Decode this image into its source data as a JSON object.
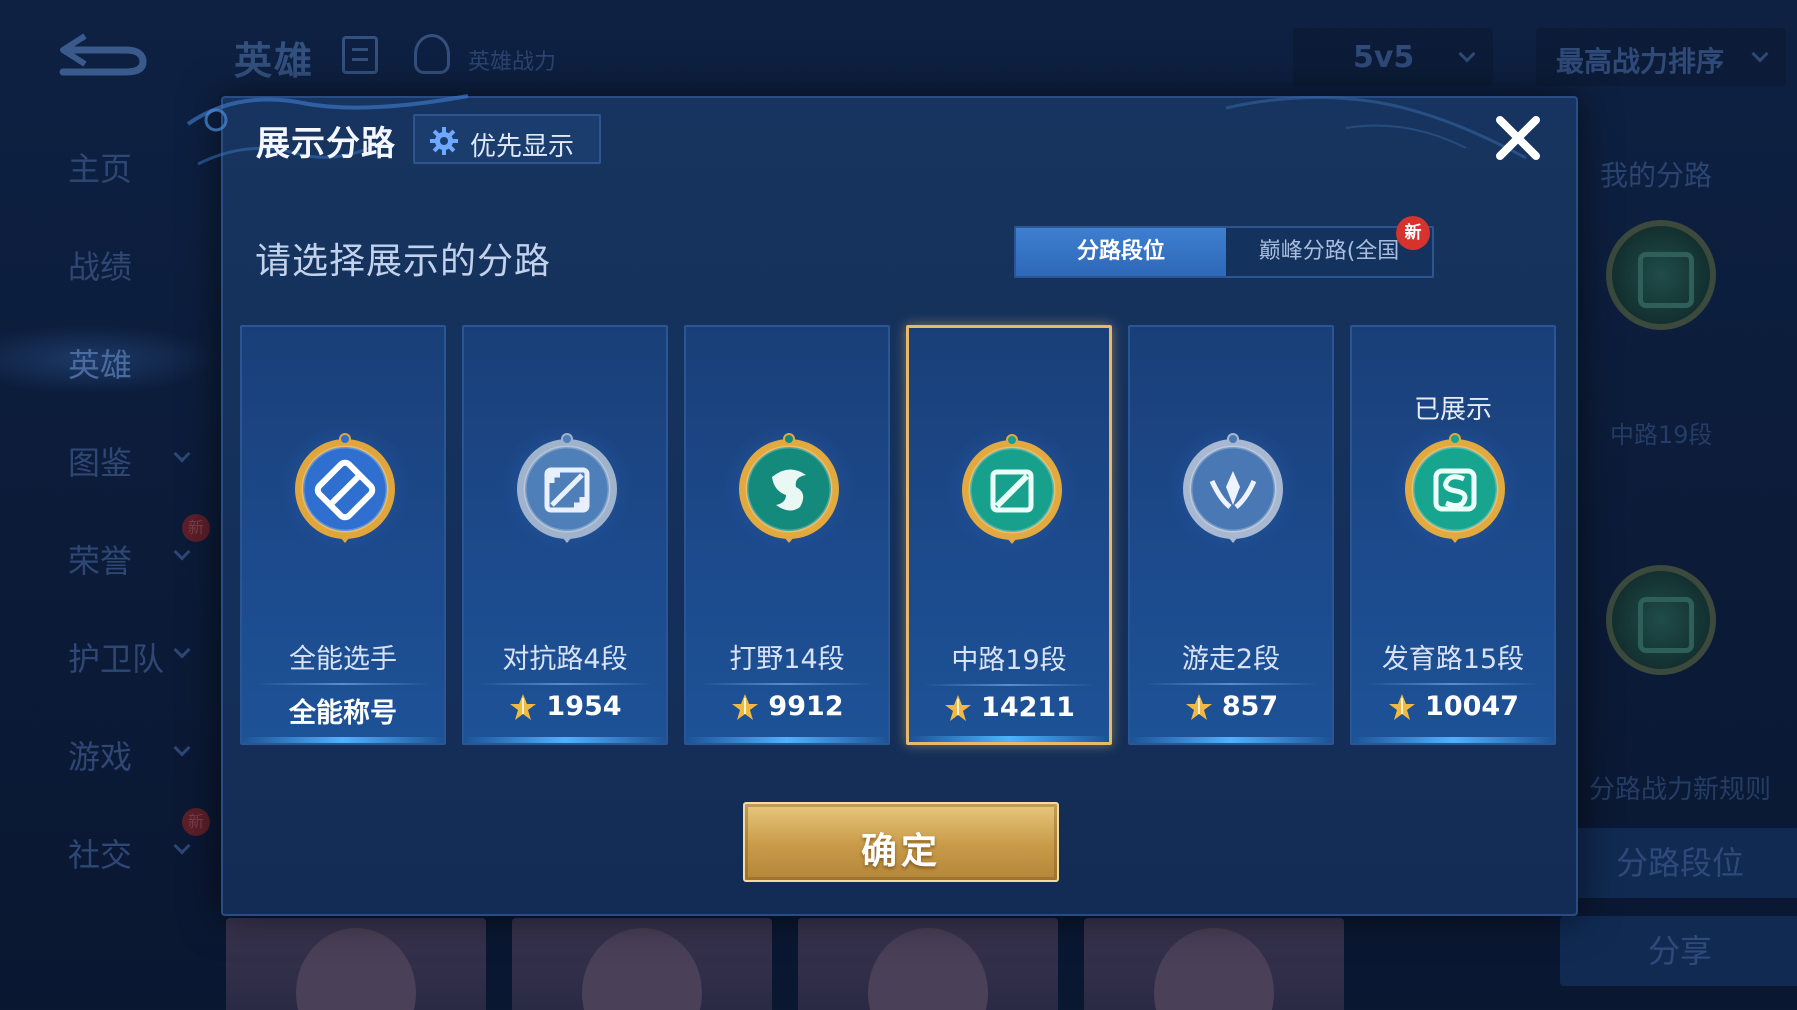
{
  "background": {
    "page_title": "英雄",
    "power_label": "英雄战力",
    "mode_select": "5v5",
    "sort_select": "最高战力排序",
    "sidebar": [
      {
        "label": "主页",
        "chevron": false,
        "new": false
      },
      {
        "label": "战绩",
        "chevron": false,
        "new": false
      },
      {
        "label": "英雄",
        "chevron": false,
        "new": false,
        "active": true
      },
      {
        "label": "图鉴",
        "chevron": true,
        "new": false
      },
      {
        "label": "荣誉",
        "chevron": true,
        "new": true
      },
      {
        "label": "护卫队",
        "chevron": true,
        "new": false
      },
      {
        "label": "游戏",
        "chevron": true,
        "new": false
      },
      {
        "label": "社交",
        "chevron": true,
        "new": true
      }
    ],
    "new_badge": "新",
    "right_panel": {
      "title": "我的分路",
      "lane_rank": "中路19段",
      "rules_link": "分路战力新规则",
      "lane_rank_button": "分路段位",
      "share_button": "分享"
    }
  },
  "dialog": {
    "title": "展示分路",
    "priority_button": "优先显示",
    "subtitle": "请选择展示的分路",
    "tabs": [
      {
        "label": "分路段位",
        "active": true
      },
      {
        "label": "巅峰分路(全国",
        "active": false
      }
    ],
    "new_tag": "新",
    "cards": [
      {
        "name": "全能选手",
        "value": "全能称号",
        "status": "",
        "selected": false,
        "has_score_icon": false,
        "emblem": "all-round",
        "rim": "#e0a63c",
        "core": "#2f6fcf"
      },
      {
        "name": "对抗路4段",
        "value": "1954",
        "status": "",
        "selected": false,
        "has_score_icon": true,
        "emblem": "clash",
        "rim": "#9fb3cc",
        "core": "#4f7fb8"
      },
      {
        "name": "打野14段",
        "value": "9912",
        "status": "",
        "selected": false,
        "has_score_icon": true,
        "emblem": "jungle",
        "rim": "#e2a93e",
        "core": "#138a7c"
      },
      {
        "name": "中路19段",
        "value": "14211",
        "status": "",
        "selected": true,
        "has_score_icon": true,
        "emblem": "mid",
        "rim": "#e2a93e",
        "core": "#17a08c"
      },
      {
        "name": "游走2段",
        "value": "857",
        "status": "",
        "selected": false,
        "has_score_icon": true,
        "emblem": "roam",
        "rim": "#a7b8d0",
        "core": "#4a78b4"
      },
      {
        "name": "发育路15段",
        "value": "10047",
        "status": "已展示",
        "selected": false,
        "has_score_icon": true,
        "emblem": "farm",
        "rim": "#e2a93e",
        "core": "#18a58f"
      }
    ],
    "confirm_button": "确定"
  },
  "colors": {
    "accent_blue": "#3e7fd0",
    "selected_gold": "#e8b96a",
    "new_red": "#d6322e"
  }
}
